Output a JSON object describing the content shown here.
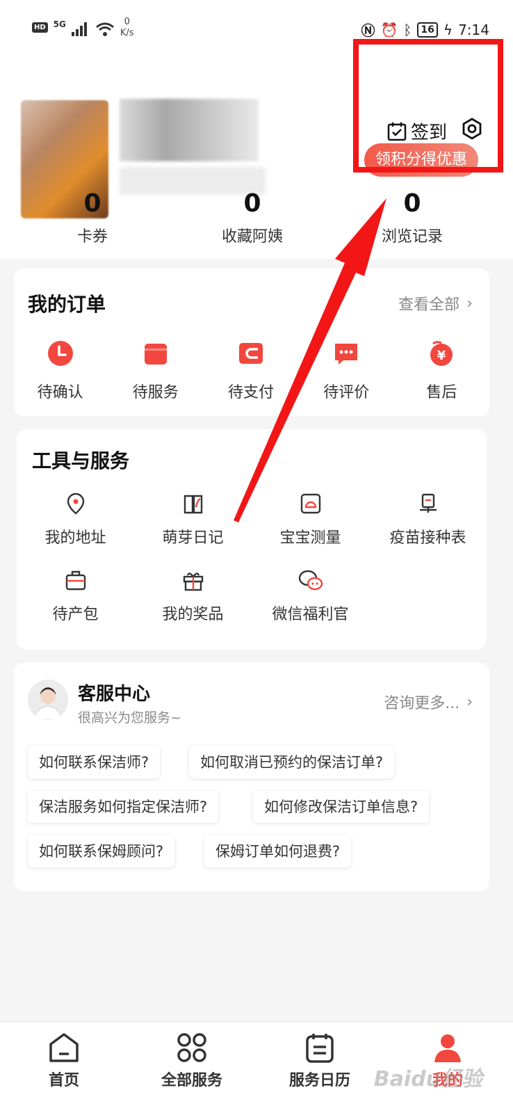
{
  "status_bar": {
    "hd": "HD",
    "signal": "5G",
    "speed_value": "0",
    "speed_unit": "K/s",
    "battery": "16",
    "time": "7:14"
  },
  "header": {
    "checkin_label": "签到",
    "promo_label": "领积分得优惠"
  },
  "stats": [
    {
      "value": "0",
      "label": "卡券"
    },
    {
      "value": "0",
      "label": "收藏阿姨"
    },
    {
      "value": "0",
      "label": "浏览记录"
    }
  ],
  "orders": {
    "title": "我的订单",
    "view_all": "查看全部",
    "items": [
      {
        "label": "待确认",
        "icon": "clock-icon"
      },
      {
        "label": "待服务",
        "icon": "calendar-icon"
      },
      {
        "label": "待支付",
        "icon": "wallet-icon"
      },
      {
        "label": "待评价",
        "icon": "comment-icon"
      },
      {
        "label": "售后",
        "icon": "yen-icon"
      }
    ]
  },
  "tools": {
    "title": "工具与服务",
    "items": [
      {
        "label": "我的地址",
        "icon": "location-icon"
      },
      {
        "label": "萌芽日记",
        "icon": "diary-icon"
      },
      {
        "label": "宝宝测量",
        "icon": "measure-icon"
      },
      {
        "label": "疫苗接种表",
        "icon": "vaccine-icon"
      },
      {
        "label": "待产包",
        "icon": "bag-icon"
      },
      {
        "label": "我的奖品",
        "icon": "gift-icon"
      },
      {
        "label": "微信福利官",
        "icon": "wechat-icon"
      }
    ]
  },
  "service": {
    "title": "客服中心",
    "subtitle": "很高兴为您服务~",
    "more": "咨询更多...",
    "faqs": [
      "如何联系保洁师?",
      "如何取消已预约的保洁订单?",
      "保洁服务如何指定保洁师?",
      "如何修改保洁订单信息?",
      "如何联系保姆顾问?",
      "保姆订单如何退费?"
    ]
  },
  "tabbar": {
    "items": [
      {
        "label": "首页",
        "icon": "home-icon"
      },
      {
        "label": "全部服务",
        "icon": "grid-icon"
      },
      {
        "label": "服务日历",
        "icon": "calendar-tab-icon"
      },
      {
        "label": "我的",
        "icon": "profile-icon"
      }
    ],
    "active_index": 3
  },
  "colors": {
    "accent": "#f2473e",
    "highlight": "#f21616"
  },
  "watermark": "Baidu经验"
}
